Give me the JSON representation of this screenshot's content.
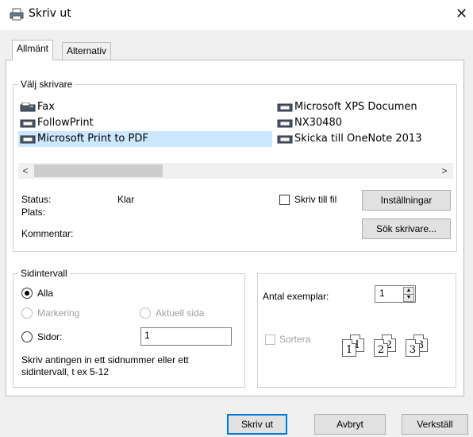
{
  "window": {
    "title": "Skriv ut",
    "close_glyph": "✕",
    "icon": "printer-icon"
  },
  "tabs": [
    {
      "label": "Allmänt",
      "active": true
    },
    {
      "label": "Alternativ",
      "active": false
    }
  ],
  "printer_group": {
    "legend": "Välj skrivare",
    "printers": [
      {
        "label": "Fax",
        "selected": false
      },
      {
        "label": "FollowPrint",
        "selected": false
      },
      {
        "label": "Microsoft Print to PDF",
        "selected": true
      },
      {
        "label": "Microsoft XPS Documen",
        "selected": false
      },
      {
        "label": "NX30480",
        "selected": false
      },
      {
        "label": "Skicka till OneNote 2013",
        "selected": false
      }
    ],
    "scroll_left": "<",
    "scroll_right": ">",
    "status_label": "Status:",
    "status_value": "Klar",
    "location_label": "Plats:",
    "comment_label": "Kommentar:",
    "print_to_file_label": "Skriv till fil",
    "preferences_button": "Inställningar",
    "find_printer_button": "Sök skrivare..."
  },
  "page_range": {
    "legend": "Sidintervall",
    "all_label": "Alla",
    "selection_label": "Markering",
    "current_page_label": "Aktuell sida",
    "pages_label": "Sidor:",
    "pages_value": "1",
    "hint": "Skriv antingen in ett sidnummer eller ett sidintervall, t ex 5-12"
  },
  "copies": {
    "label": "Antal exemplar:",
    "value": "1",
    "collate_label": "Sortera",
    "collate_pages": [
      "1",
      "1",
      "2",
      "2",
      "3",
      "3"
    ]
  },
  "footer": {
    "print_button": "Skriv ut",
    "cancel_button": "Avbryt",
    "apply_button": "Verkställ"
  }
}
